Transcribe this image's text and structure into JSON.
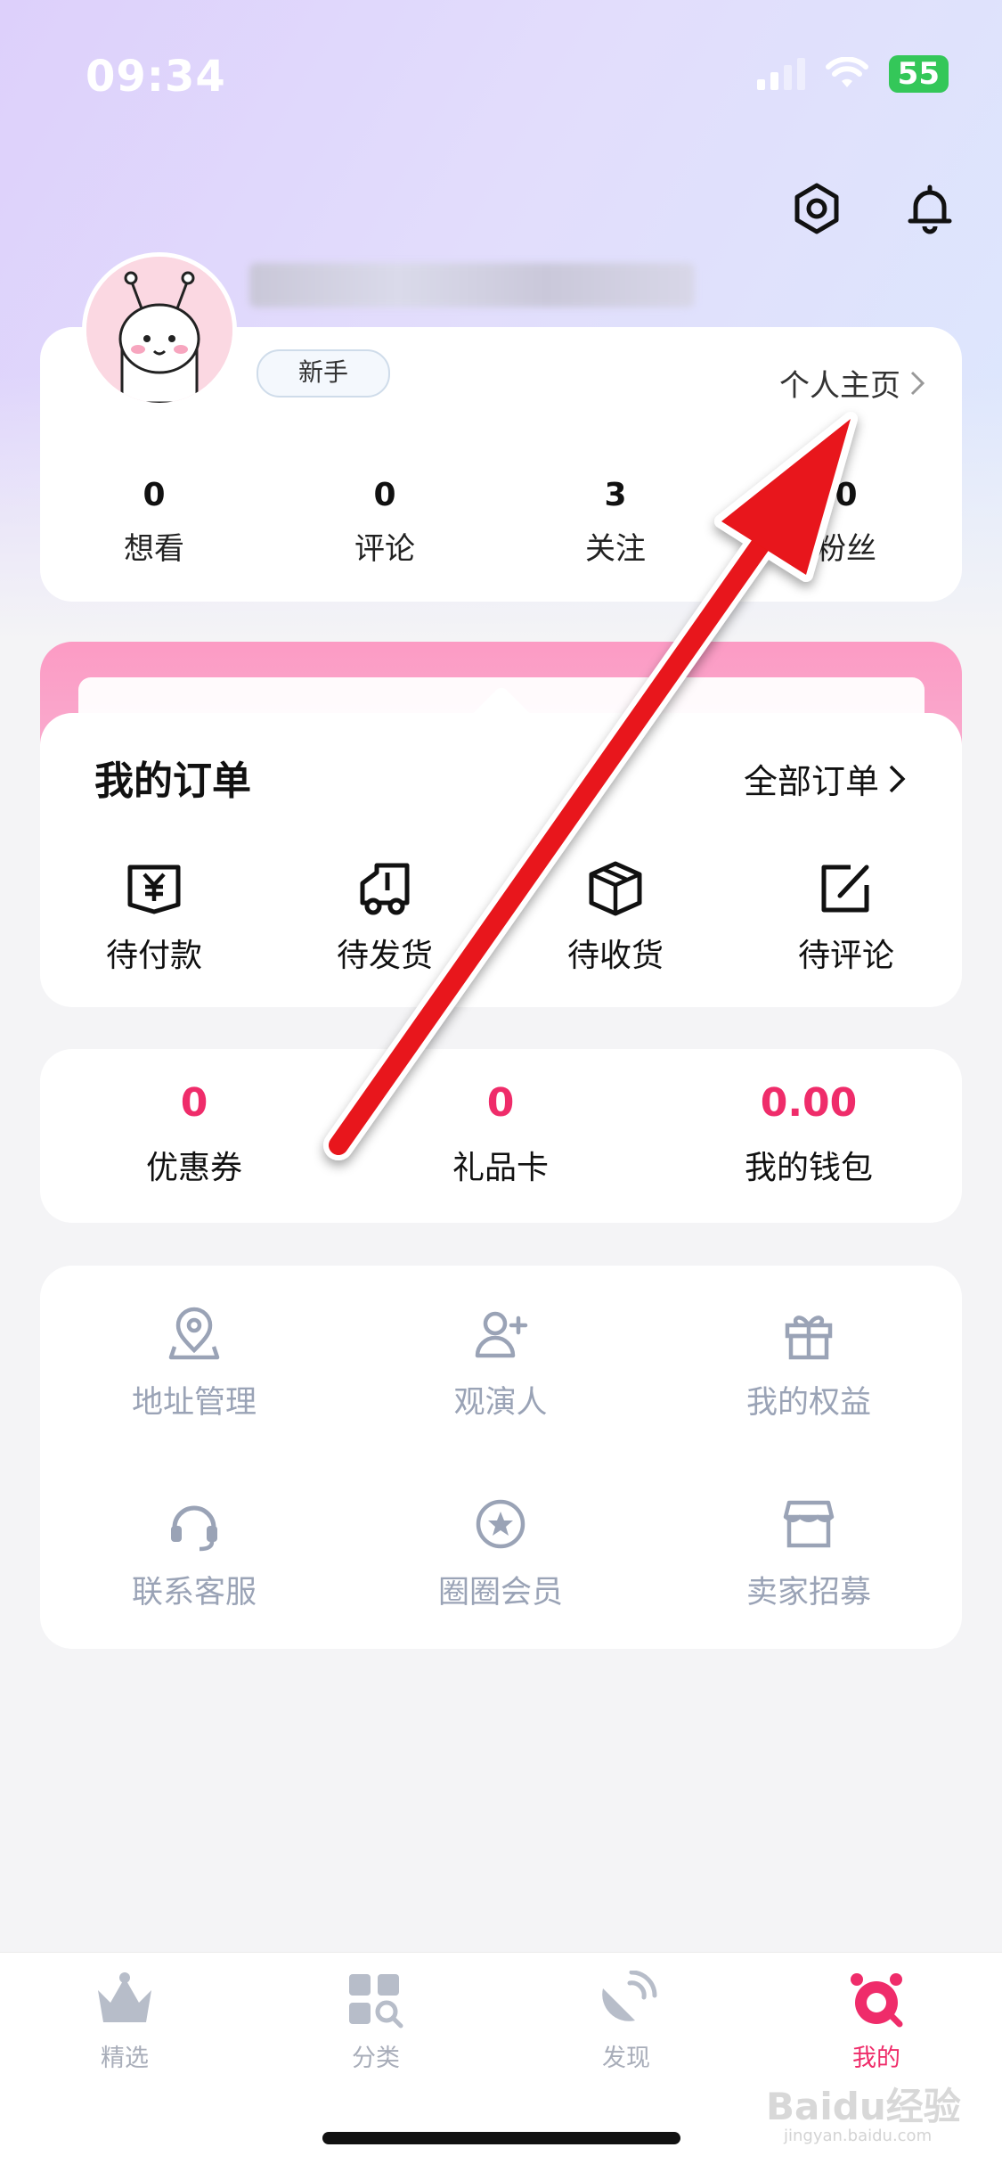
{
  "status_bar": {
    "time": "09:34",
    "battery": "55"
  },
  "profile": {
    "badge": "新手",
    "homepage_link": "个人主页",
    "stats": [
      {
        "count": "0",
        "label": "想看"
      },
      {
        "count": "0",
        "label": "评论"
      },
      {
        "count": "3",
        "label": "关注"
      },
      {
        "count": "0",
        "label": "粉丝"
      }
    ]
  },
  "orders": {
    "title": "我的订单",
    "all_link": "全部订单",
    "items": [
      {
        "label": "待付款",
        "icon": "payment-icon"
      },
      {
        "label": "待发货",
        "icon": "truck-icon"
      },
      {
        "label": "待收货",
        "icon": "package-icon"
      },
      {
        "label": "待评论",
        "icon": "edit-icon"
      }
    ]
  },
  "wallet": [
    {
      "value": "0",
      "label": "优惠券"
    },
    {
      "value": "0",
      "label": "礼品卡"
    },
    {
      "value": "0.00",
      "label": "我的钱包"
    }
  ],
  "services": [
    {
      "label": "地址管理",
      "icon": "location-icon"
    },
    {
      "label": "观演人",
      "icon": "add-person-icon"
    },
    {
      "label": "我的权益",
      "icon": "gift-icon"
    },
    {
      "label": "联系客服",
      "icon": "headset-icon"
    },
    {
      "label": "圈圈会员",
      "icon": "star-badge-icon"
    },
    {
      "label": "卖家招募",
      "icon": "store-icon"
    }
  ],
  "tabbar": [
    {
      "label": "精选",
      "icon": "crown-icon",
      "active": false
    },
    {
      "label": "分类",
      "icon": "grid-search-icon",
      "active": false
    },
    {
      "label": "发现",
      "icon": "satellite-dish-icon",
      "active": false
    },
    {
      "label": "我的",
      "icon": "profile-face-icon",
      "active": true
    }
  ],
  "watermark": {
    "brand": "Baidu经验",
    "url": "jingyan.baidu.com"
  },
  "colors": {
    "accent": "#ef2c6a",
    "wallet_value": "#ef2c6a",
    "arrow": "#e8161a",
    "service_icon": "#9aa3b6"
  }
}
